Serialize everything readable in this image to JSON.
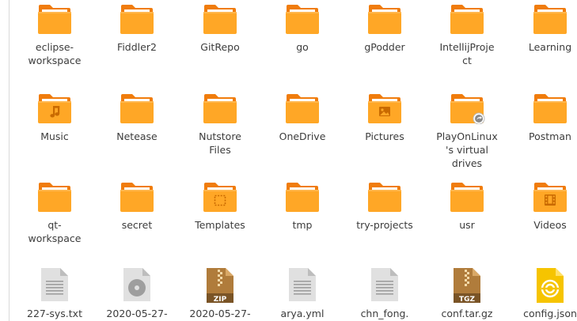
{
  "colors": {
    "folder_back": "#f07c0c",
    "folder_front": "#ffa726",
    "folder_front_light": "#ffb74d",
    "emblem": "#c96a00",
    "file_gray": "#cfcfcf",
    "archive": "#b07c3b",
    "config": "#f6c400",
    "text": "#3c3c3c"
  },
  "rows": [
    [
      {
        "name": "eclipse-\nworkspace",
        "type": "folder",
        "emblem": "none"
      },
      {
        "name": "Fiddler2",
        "type": "folder",
        "emblem": "none"
      },
      {
        "name": "GitRepo",
        "type": "folder",
        "emblem": "none"
      },
      {
        "name": "go",
        "type": "folder",
        "emblem": "none"
      },
      {
        "name": "gPodder",
        "type": "folder",
        "emblem": "none"
      },
      {
        "name": "IntellijProje\nct",
        "type": "folder",
        "emblem": "none"
      },
      {
        "name": "Learning",
        "type": "folder",
        "emblem": "none"
      }
    ],
    [
      {
        "name": "Music",
        "type": "folder",
        "emblem": "music-note"
      },
      {
        "name": "Netease",
        "type": "folder",
        "emblem": "none"
      },
      {
        "name": "Nutstore\nFiles",
        "type": "folder",
        "emblem": "none"
      },
      {
        "name": "OneDrive",
        "type": "folder",
        "emblem": "none"
      },
      {
        "name": "Pictures",
        "type": "folder",
        "emblem": "picture"
      },
      {
        "name": "PlayOnLinux\n's virtual\ndrives",
        "type": "folder",
        "emblem": "symlink"
      },
      {
        "name": "Postman",
        "type": "folder",
        "emblem": "none"
      }
    ],
    [
      {
        "name": "qt-\nworkspace",
        "type": "folder",
        "emblem": "none"
      },
      {
        "name": "secret",
        "type": "folder",
        "emblem": "none"
      },
      {
        "name": "Templates",
        "type": "folder",
        "emblem": "template"
      },
      {
        "name": "tmp",
        "type": "folder",
        "emblem": "none"
      },
      {
        "name": "try-projects",
        "type": "folder",
        "emblem": "none"
      },
      {
        "name": "usr",
        "type": "folder",
        "emblem": "none"
      },
      {
        "name": "Videos",
        "type": "folder",
        "emblem": "film"
      }
    ],
    [
      {
        "name": "227-sys.txt",
        "type": "text-file",
        "emblem": "none"
      },
      {
        "name": "2020-05-27-",
        "type": "disc-image",
        "emblem": "none"
      },
      {
        "name": "2020-05-27-",
        "type": "archive",
        "emblem": "ZIP"
      },
      {
        "name": "arya.yml",
        "type": "text-file",
        "emblem": "none"
      },
      {
        "name": "chn_fong.",
        "type": "text-file",
        "emblem": "none"
      },
      {
        "name": "conf.tar.gz",
        "type": "archive",
        "emblem": "TGZ"
      },
      {
        "name": "config.json",
        "type": "config-file",
        "emblem": "none"
      }
    ]
  ]
}
